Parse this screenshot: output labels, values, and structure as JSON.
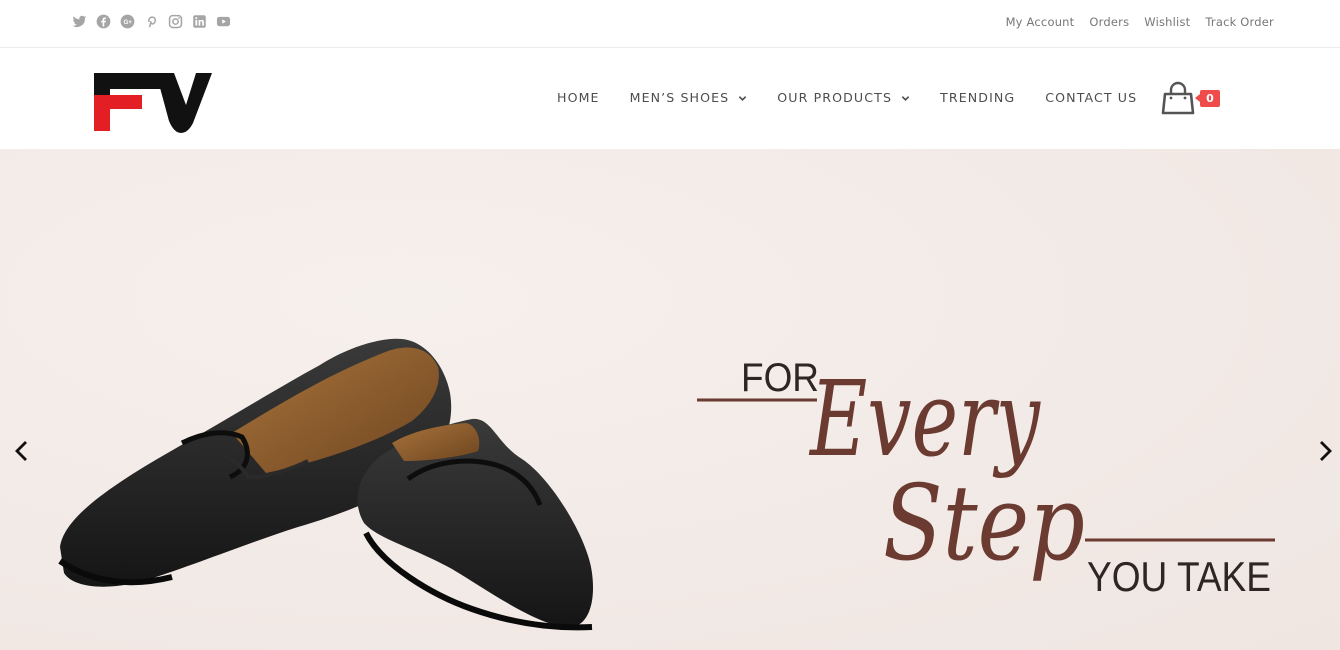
{
  "social_icons": [
    "twitter-icon",
    "facebook-icon",
    "google-plus-icon",
    "pinterest-icon",
    "instagram-icon",
    "linkedin-icon",
    "youtube-icon"
  ],
  "top_links": [
    "My Account",
    "Orders",
    "Wishlist",
    "Track Order"
  ],
  "nav": {
    "home": "HOME",
    "mens_shoes": "MEN’S SHOES",
    "our_products": "OUR PRODUCTS",
    "trending": "TRENDING",
    "contact_us": "CONTACT US"
  },
  "cart": {
    "count": "0"
  },
  "hero": {
    "for": "FOR",
    "every": "Every",
    "step": "Step",
    "you_take": "YOU TAKE"
  },
  "colors": {
    "brand_red": "#e31e24",
    "brand_black": "#111111",
    "badge": "#ef4b4b",
    "tagline_brown": "#6b3a30",
    "hero_bg": "#f3ebe7"
  }
}
